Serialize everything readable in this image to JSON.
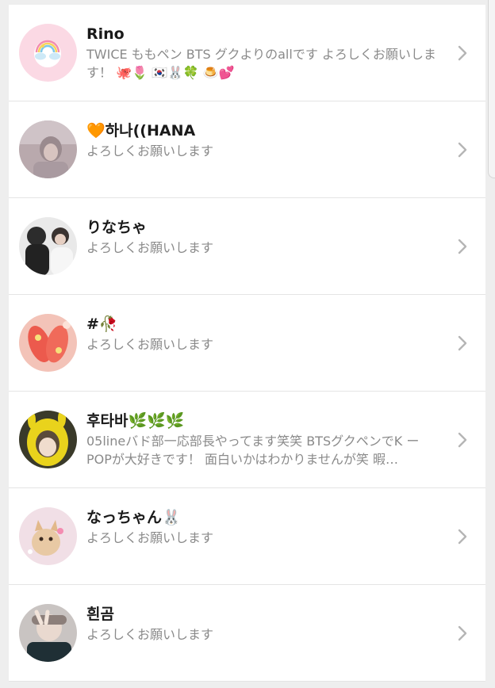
{
  "friends": [
    {
      "name": "Rino",
      "bio": "TWICE ももペン BTS グクよりのallです よろしくお願いします！ 🐙🌷 🇰🇷🐰🍀 🍮💕",
      "avatar_icon": "rainbow-cloud-avatar"
    },
    {
      "name": "🧡하나((HANA",
      "bio": "よろしくお願いします",
      "avatar_icon": "person-photo-avatar"
    },
    {
      "name": "りなちゃ",
      "bio": "よろしくお願いします",
      "avatar_icon": "two-people-photo-avatar"
    },
    {
      "name": "#🥀",
      "bio": "よろしくお願いします",
      "avatar_icon": "red-slippers-photo-avatar"
    },
    {
      "name": "후타바🌿🌿🌿",
      "bio": "05lineバド部一応部長やってます笑笑 BTSグクペンでK ーPOPが大好きです！ 面白いかはわかりませんが笑 暇…",
      "avatar_icon": "yellow-hood-photo-avatar"
    },
    {
      "name": "なっちゃん🐰",
      "bio": "よろしくお願いします",
      "avatar_icon": "kitten-photo-avatar"
    },
    {
      "name": "흰곰",
      "bio": "よろしくお願いします",
      "avatar_icon": "peace-sign-photo-avatar"
    }
  ],
  "chevron_icon": "chevron-right-icon",
  "colors": {
    "name": "#1a1a1a",
    "bio": "#8a8a8a",
    "chevron": "#b5b5b5",
    "divider": "#e4e4e4"
  }
}
